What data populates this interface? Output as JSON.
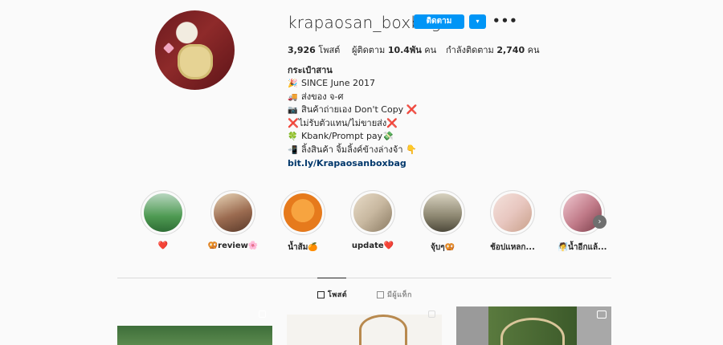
{
  "profile": {
    "username": "krapaosan_boxbag",
    "follow_label": "ติดตาม",
    "dropdown_label": "▾",
    "more_label": "•••"
  },
  "stats": {
    "posts_value": "3,926",
    "posts_label": "โพสต์",
    "followers_label": "ผู้ติดตาม",
    "followers_value": "10.4พัน",
    "followers_unit": "คน",
    "following_label": "กำลังติดตาม",
    "following_value": "2,740",
    "following_unit": "คน"
  },
  "bio": {
    "name": "กระเป๋าสาน",
    "lines": [
      {
        "icon": "🎉",
        "text": "SINCE June 2017"
      },
      {
        "icon": "🚚",
        "text": "ส่งของ จ-ศ"
      },
      {
        "icon": "📷",
        "text": "สินค้าถ่ายเอง Don't Copy ❌"
      },
      {
        "icon": "",
        "text": "❌ไม่รับตัวแทน/ไม่ขายส่ง❌"
      },
      {
        "icon": "🍀",
        "text": "Kbank/Prompt pay💸"
      },
      {
        "icon": "📲",
        "text": "ลิ้งสินค้า จิ้มลิ้งค์ข้างล่างจ้า 👇"
      }
    ],
    "link": "bit.ly/Krapaosanboxbag"
  },
  "highlights": [
    {
      "label": "❤️",
      "color": "#4e9a52"
    },
    {
      "label": "🥨review🌸",
      "color": "#9b6b50"
    },
    {
      "label": "น้ำส้ม🍊",
      "color": "#e67a1c"
    },
    {
      "label": "update❤️",
      "color": "#c8b8a0"
    },
    {
      "label": "จุ้บๆ🥨",
      "color": "#8c8670"
    },
    {
      "label": "ช้อปแหลก...",
      "color": "#e8c7c0"
    },
    {
      "label": "🧖น้ำอีกแล้...",
      "color": "#c07a88"
    }
  ],
  "tabs": {
    "posts": "โพสต์",
    "tagged": "มีผู้แท็ก"
  },
  "icons": {
    "grid": "grid-icon",
    "tag": "tag-icon",
    "next": "chevron-right-icon"
  }
}
